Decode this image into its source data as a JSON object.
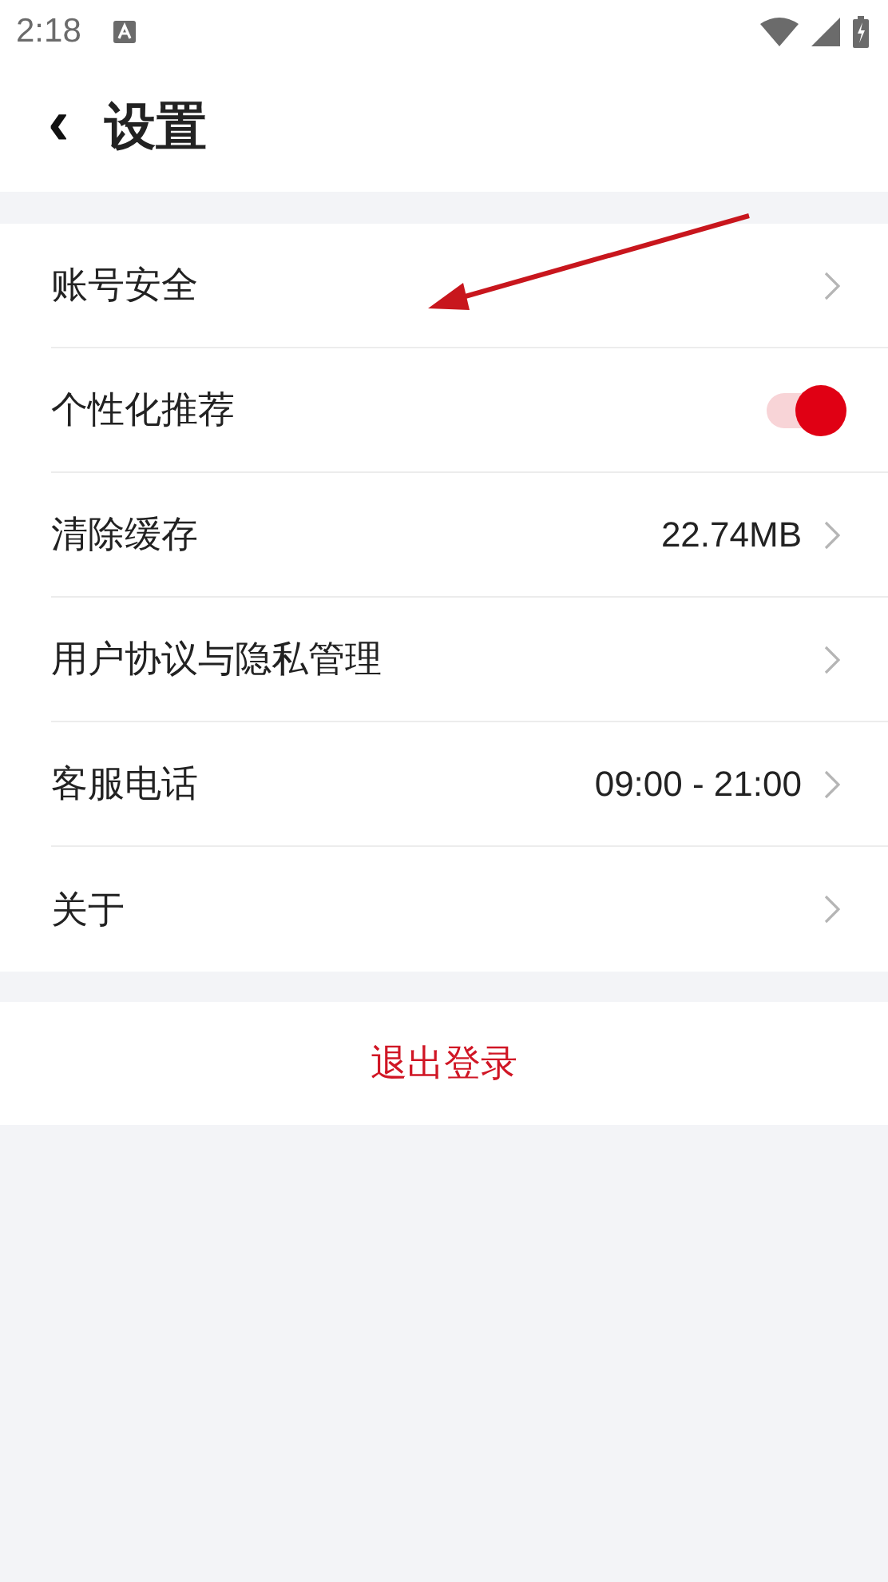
{
  "status_bar": {
    "time": "2:18"
  },
  "header": {
    "back": "‹",
    "title": "设置"
  },
  "settings": [
    {
      "kind": "link",
      "label": "账号安全"
    },
    {
      "kind": "toggle",
      "label": "个性化推荐",
      "on": true
    },
    {
      "kind": "link",
      "label": "清除缓存",
      "value": "22.74MB"
    },
    {
      "kind": "link",
      "label": "用户协议与隐私管理"
    },
    {
      "kind": "link",
      "label": "客服电话",
      "value": "09:00 - 21:00"
    },
    {
      "kind": "link",
      "label": "关于"
    }
  ],
  "logout": "退出登录"
}
